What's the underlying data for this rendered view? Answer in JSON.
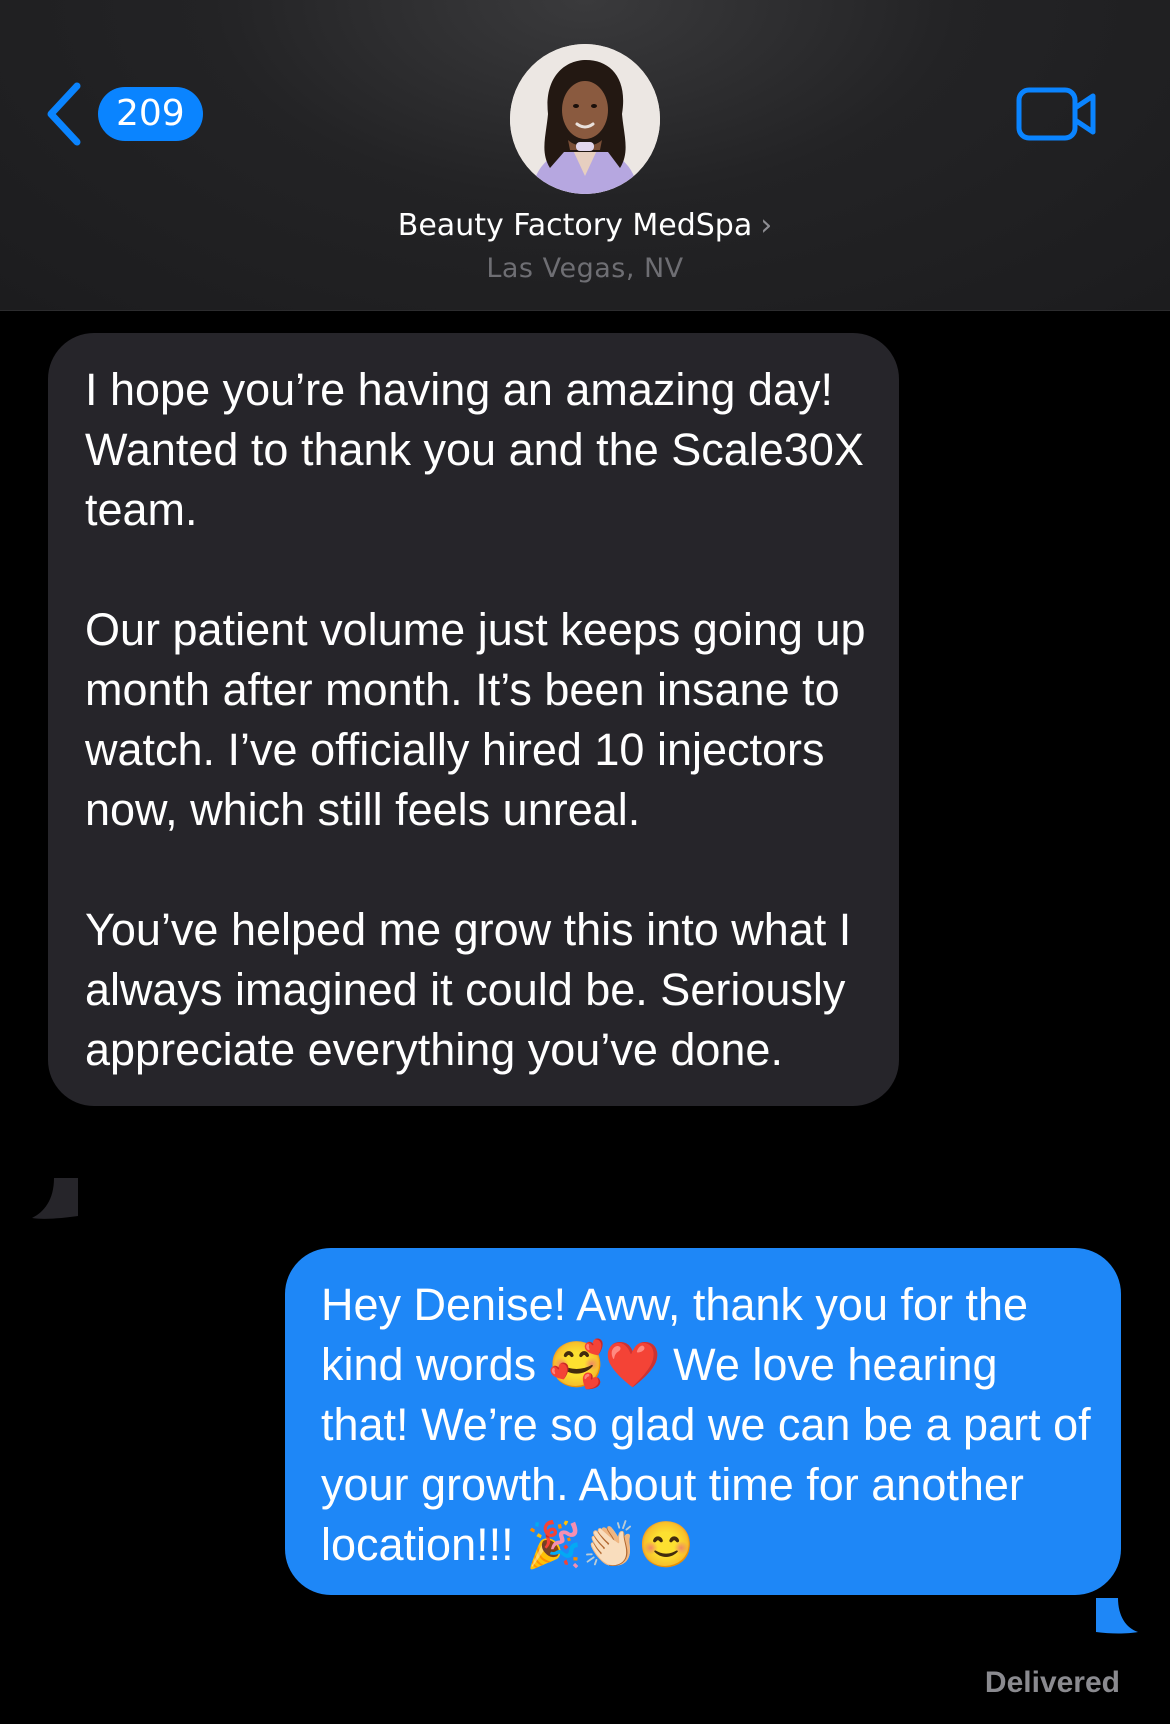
{
  "header": {
    "unread_count": "209",
    "contact_name": "Beauty Factory MedSpa",
    "contact_subtitle": "Las Vegas, NV",
    "back_icon": "chevron-left-icon",
    "video_icon": "video-camera-icon",
    "avatar": "contact-photo"
  },
  "messages": [
    {
      "direction": "incoming",
      "text": "I hope you’re having an amazing day! Wanted to thank you and the Scale30X team.\n\nOur patient volume just keeps going up month after month. It’s been insane to watch. I’ve officially hired 10 injectors now, which still feels unreal.\n\nYou’ve helped me grow this into what I always imagined it could be. Seriously appreciate everything you’ve done."
    },
    {
      "direction": "outgoing",
      "text": "Hey Denise! Aww, thank you for the kind words 🥰❤️ We love hearing that! We’re so glad we can be a part of your growth. About time for another location!!! 🎉👏🏻😊"
    }
  ],
  "status": {
    "delivered_label": "Delivered"
  },
  "colors": {
    "accent": "#0a84ff",
    "incoming_bubble": "#26252a",
    "outgoing_bubble": "#1e87f7",
    "background": "#000000"
  }
}
